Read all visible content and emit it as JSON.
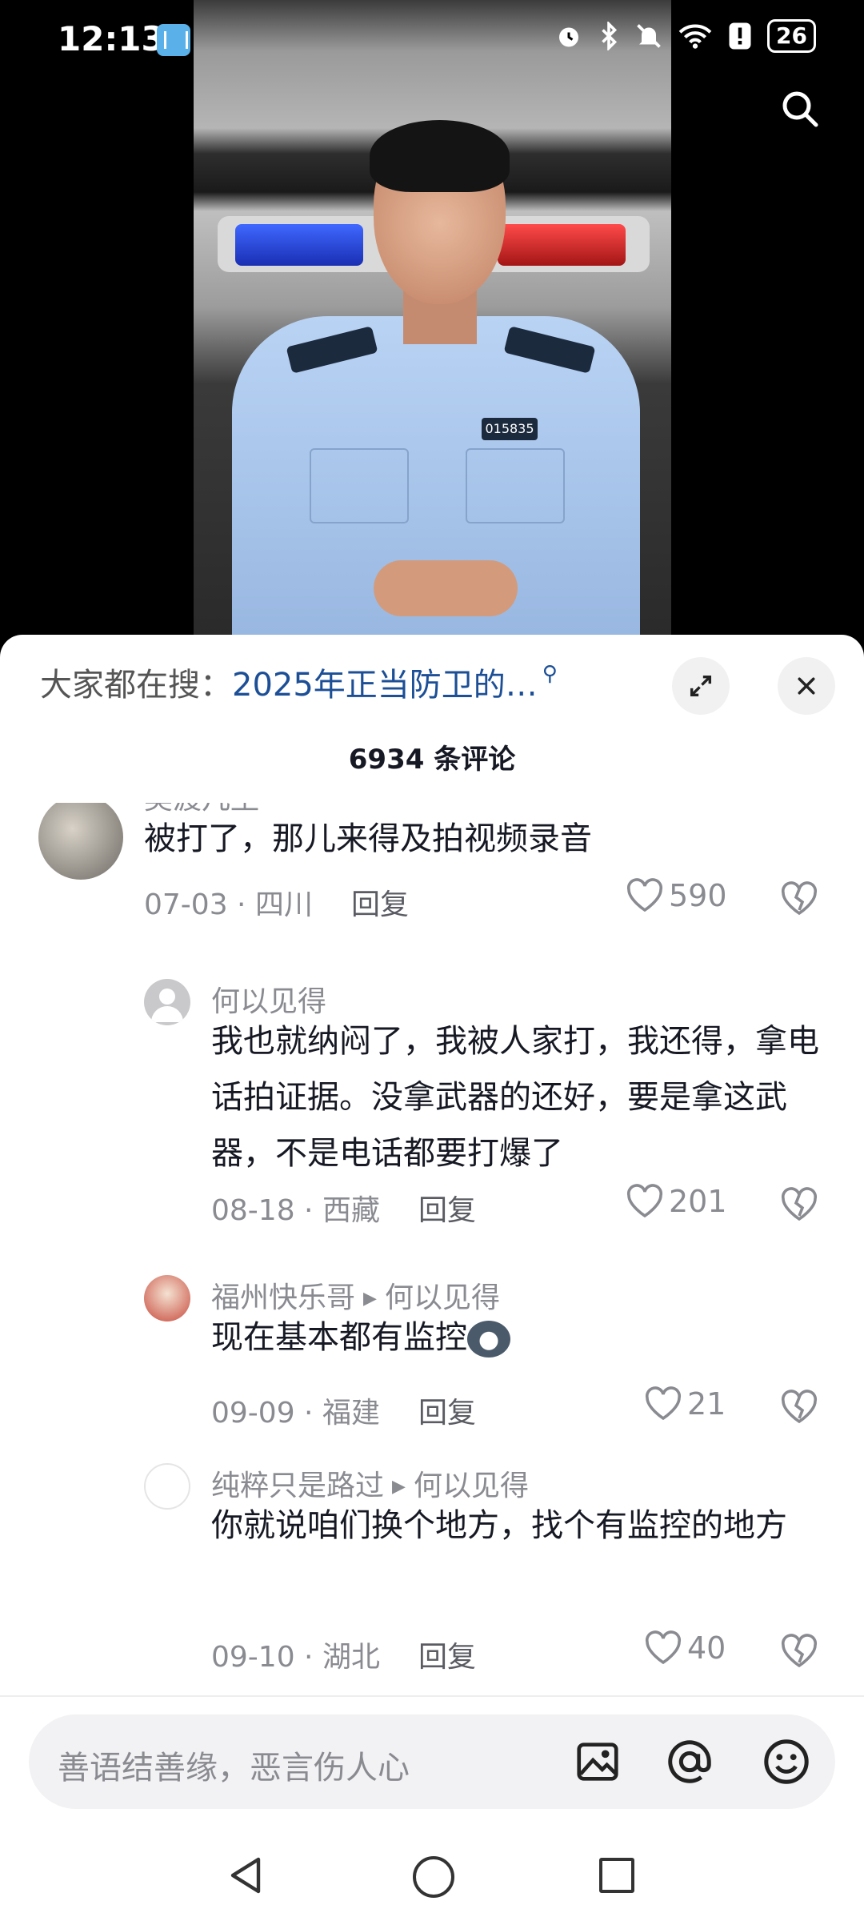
{
  "status_bar": {
    "time": "12:13",
    "battery": "26"
  },
  "video": {
    "badge_number": "015835"
  },
  "comments_panel": {
    "hot_search_prefix": "大家都在搜：",
    "hot_search_query": "2025年正当防卫的…",
    "comment_count": "6934 条评论",
    "reply_label": "回复",
    "comments": [
      {
        "user": "吴渡凡尘",
        "text": "被打了，那儿来得及拍视频录音",
        "date": "07-03",
        "location": "四川",
        "likes": "590"
      },
      {
        "user": "何以见得",
        "text": "我也就纳闷了，我被人家打，我还得，拿电话拍证据。没拿武器的还好，要是拿这武器，不是电话都要打爆了",
        "date": "08-18",
        "location": "西藏",
        "likes": "201"
      },
      {
        "user": "福州快乐哥",
        "reply_to": "何以见得",
        "text": "现在基本都有监控",
        "date": "09-09",
        "location": "福建",
        "likes": "21"
      },
      {
        "user": "纯粹只是路过",
        "reply_to": "何以见得",
        "text": "你就说咱们换个地方，找个有监控的地方",
        "date": "09-10",
        "location": "湖北",
        "likes": "40"
      }
    ],
    "input_placeholder": "善语结善缘，恶言伤人心"
  },
  "icons": [
    "book-icon",
    "alarm-icon",
    "bluetooth-icon",
    "mute-icon",
    "wifi-icon",
    "alert-icon",
    "search-icon",
    "expand-icon",
    "close-icon",
    "heart-icon",
    "dislike-icon",
    "image-icon",
    "at-icon",
    "emoji-icon",
    "back-icon",
    "home-icon",
    "recents-icon"
  ],
  "colors": {
    "accent_link": "#1c4f96",
    "muted_text": "#8a8b91",
    "text": "#161823"
  }
}
